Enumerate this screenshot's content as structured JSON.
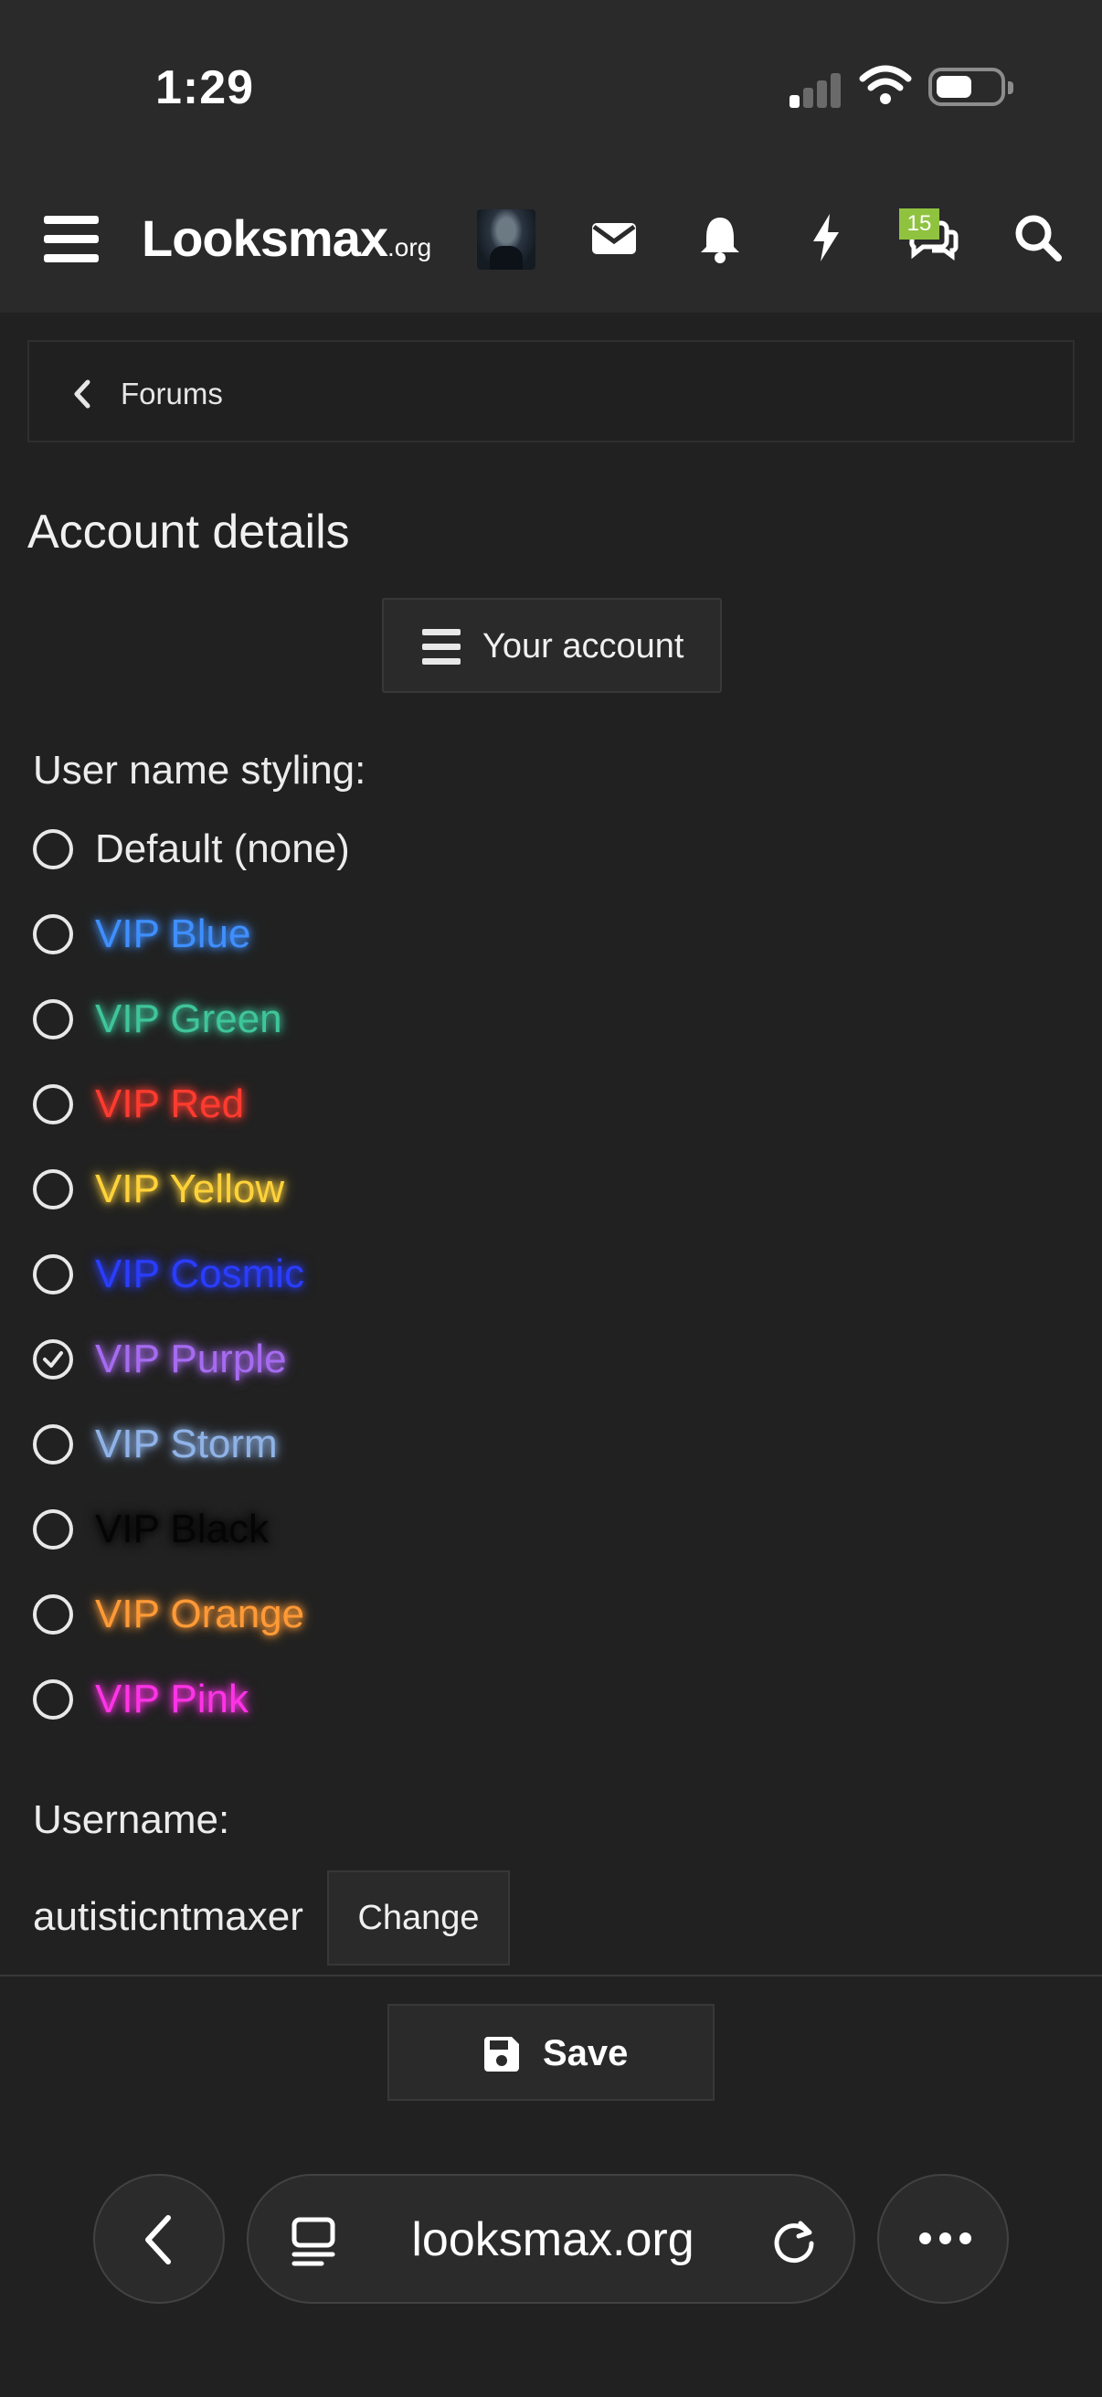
{
  "status_bar": {
    "time": "1:29"
  },
  "header": {
    "logo_text": "Looksmax",
    "logo_suffix": ".org",
    "chat_badge": "15",
    "icons": [
      "menu-icon",
      "avatar",
      "mail-icon",
      "bell-icon",
      "bolt-icon",
      "chat-icon",
      "search-icon"
    ]
  },
  "breadcrumb": {
    "label": "Forums"
  },
  "page": {
    "title": "Account details",
    "account_button": "Your account",
    "styling_label": "User name styling:",
    "styling_options": [
      {
        "label": "Default (none)",
        "color": "#ececec",
        "selected": false
      },
      {
        "label": "VIP Blue",
        "color": "#3f8fff",
        "selected": false
      },
      {
        "label": "VIP Green",
        "color": "#3fc59a",
        "selected": false
      },
      {
        "label": "VIP Red",
        "color": "#ff3b2f",
        "selected": false
      },
      {
        "label": "VIP Yellow",
        "color": "#ffd23a",
        "selected": false
      },
      {
        "label": "VIP Cosmic",
        "color": "#2a3dff",
        "selected": false
      },
      {
        "label": "VIP Purple",
        "color": "#a66bf0",
        "selected": true
      },
      {
        "label": "VIP Storm",
        "color": "#8fb3e8",
        "selected": false
      },
      {
        "label": "VIP Black",
        "color": "#050505",
        "selected": false
      },
      {
        "label": "VIP Orange",
        "color": "#ff9a36",
        "selected": false
      },
      {
        "label": "VIP Pink",
        "color": "#ff33e6",
        "selected": false
      }
    ],
    "username_label": "Username:",
    "username_value": "autisticntmaxer",
    "change_button": "Change",
    "save_button": "Save"
  },
  "browser": {
    "url": "looksmax.org"
  }
}
